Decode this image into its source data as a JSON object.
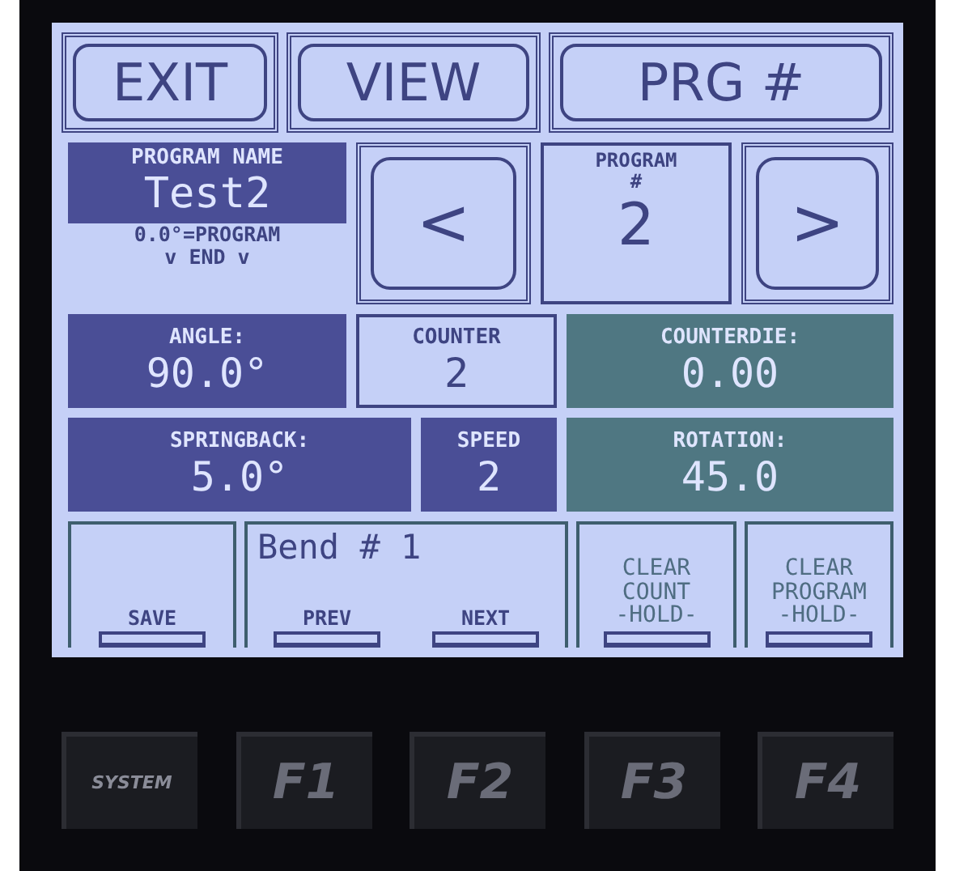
{
  "screen": {
    "top_buttons": [
      {
        "label": "EXIT"
      },
      {
        "label": "VIEW"
      },
      {
        "label": "PRG #"
      }
    ],
    "program_name": {
      "label": "PROGRAM NAME",
      "value": "Test2",
      "hint": [
        "0.0°=PROGRAM",
        "v END v"
      ]
    },
    "prev_button": "<",
    "program_number": {
      "label": [
        "PROGRAM",
        "#"
      ],
      "value": "2"
    },
    "next_button": ">",
    "field_rows": [
      [
        {
          "label": "ANGLE:",
          "value": "90.0°",
          "kind": "filled",
          "color": "#4a4e96"
        },
        {
          "label": "COUNTER",
          "value": "2",
          "kind": "outlined",
          "color": "#c5d0f7"
        },
        {
          "label": "COUNTERDIE:",
          "value": "0.00",
          "kind": "filled",
          "color": "#4f7782"
        }
      ],
      [
        {
          "label": "SPRINGBACK:",
          "value": "5.0°",
          "kind": "filled",
          "color": "#4a4e96"
        },
        {
          "label": "SPEED",
          "value": "2",
          "kind": "filled",
          "color": "#4a4e96"
        },
        {
          "label": "ROTATION:",
          "value": "45.0",
          "kind": "filled",
          "color": "#4f7782"
        }
      ]
    ],
    "bend_display": "Bend #  1",
    "softkeys": [
      {
        "label": [
          "SAVE"
        ]
      },
      {
        "label": [
          "PREV"
        ]
      },
      {
        "label": [
          "NEXT"
        ]
      },
      {
        "label": [
          "CLEAR",
          "COUNT",
          "-HOLD-"
        ]
      },
      {
        "label": [
          "CLEAR",
          "PROGRAM",
          "-HOLD-"
        ]
      }
    ]
  },
  "hardware_keys": [
    {
      "label": "SYSTEM"
    },
    {
      "label": "F1"
    },
    {
      "label": "F2"
    },
    {
      "label": "F3"
    },
    {
      "label": "F4"
    }
  ]
}
